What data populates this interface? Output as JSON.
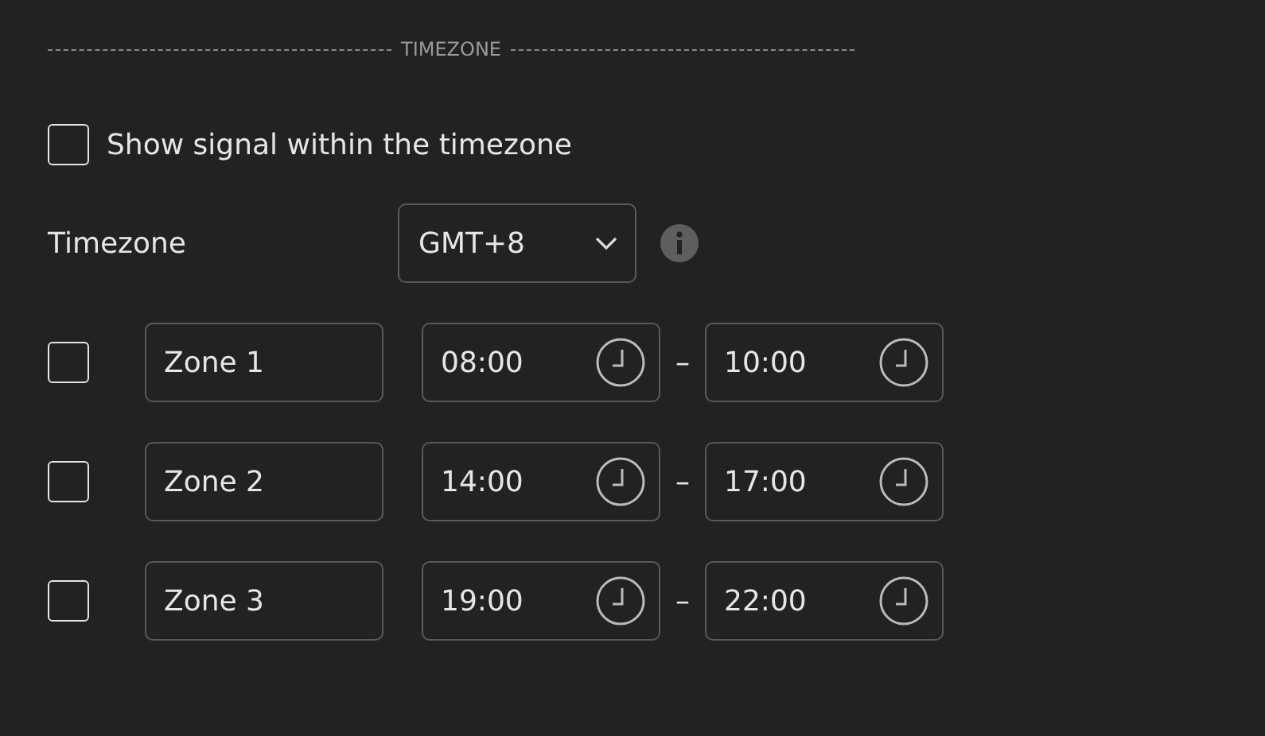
{
  "section_title": "TIMEZONE",
  "show_signal": {
    "label": "Show signal within the timezone",
    "checked": false
  },
  "timezone": {
    "label": "Timezone",
    "value": "GMT+8"
  },
  "zones": [
    {
      "checked": false,
      "name": "Zone 1",
      "start": "08:00",
      "separator": "–",
      "end": "10:00"
    },
    {
      "checked": false,
      "name": "Zone 2",
      "start": "14:00",
      "separator": "–",
      "end": "17:00"
    },
    {
      "checked": false,
      "name": "Zone 3",
      "start": "19:00",
      "separator": "–",
      "end": "22:00"
    }
  ]
}
